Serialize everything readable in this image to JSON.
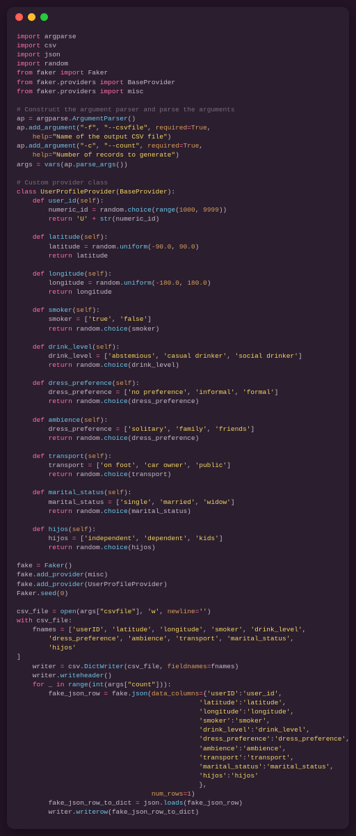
{
  "titlebar": {
    "red": "close",
    "yellow": "minimize",
    "green": "maximize"
  },
  "code": {
    "l1_kw1": "import",
    "l1_mod": "argparse",
    "l2_kw1": "import",
    "l2_mod": "csv",
    "l3_kw1": "import",
    "l3_mod": "json",
    "l4_kw1": "import",
    "l4_mod": "random",
    "l5_kw1": "from",
    "l5_mod1": "faker",
    "l5_kw2": "import",
    "l5_mod2": "Faker",
    "l6_kw1": "from",
    "l6_mod1": "faker.providers",
    "l6_kw2": "import",
    "l6_mod2": "BaseProvider",
    "l7_kw1": "from",
    "l7_mod1": "faker.providers",
    "l7_kw2": "import",
    "l7_mod2": "misc",
    "l9_c": "# Construct the argument parser and parse the arguments",
    "l10a": "ap ",
    "l10b": "=",
    "l10c": " argparse.",
    "l10d": "ArgumentParser",
    "l10e": "()",
    "l11a": "ap.",
    "l11b": "add_argument",
    "l11c": "(",
    "l11d": "\"-f\"",
    "l11e": ", ",
    "l11f": "\"--csvfile\"",
    "l11g": ", ",
    "l11h": "required",
    "l11i": "=",
    "l11j": "True",
    "l11k": ",",
    "l12a": "    ",
    "l12b": "help",
    "l12c": "=",
    "l12d": "\"Name of the output CSV file\"",
    "l12e": ")",
    "l13a": "ap.",
    "l13b": "add_argument",
    "l13c": "(",
    "l13d": "\"-c\"",
    "l13e": ", ",
    "l13f": "\"--count\"",
    "l13g": ", ",
    "l13h": "required",
    "l13i": "=",
    "l13j": "True",
    "l13k": ",",
    "l14a": "    ",
    "l14b": "help",
    "l14c": "=",
    "l14d": "\"Number of records to generate\"",
    "l14e": ")",
    "l15a": "args ",
    "l15b": "=",
    "l15c": " ",
    "l15d": "vars",
    "l15e": "(ap.",
    "l15f": "parse_args",
    "l15g": "())",
    "l17_c": "# Custom provider class",
    "l18_kw": "class",
    "l18_n": " UserProfileProvider",
    "l18_p": "(",
    "l18_b": "BaseProvider",
    "l18_e": "):",
    "l19_kw": "def",
    "l19_n": " user_id",
    "l19_p": "(",
    "l19_s": "self",
    "l19_e": "):",
    "l20a": "        numeric_id ",
    "l20b": "=",
    "l20c": " random.",
    "l20d": "choice",
    "l20e": "(",
    "l20f": "range",
    "l20g": "(",
    "l20h": "1000",
    "l20i": ", ",
    "l20j": "9999",
    "l20k": "))",
    "l21_kw": "return",
    "l21a": " ",
    "l21b": "'U'",
    "l21c": " ",
    "l21d": "+",
    "l21e": " ",
    "l21f": "str",
    "l21g": "(numeric_id)",
    "l23_kw": "def",
    "l23_n": " latitude",
    "l23_p": "(",
    "l23_s": "self",
    "l23_e": "):",
    "l24a": "        latitude ",
    "l24b": "=",
    "l24c": " random.",
    "l24d": "uniform",
    "l24e": "(",
    "l24f": "-",
    "l24g": "90.0",
    "l24h": ", ",
    "l24i": "90.0",
    "l24j": ")",
    "l25_kw": "return",
    "l25a": " latitude",
    "l27_kw": "def",
    "l27_n": " longitude",
    "l27_p": "(",
    "l27_s": "self",
    "l27_e": "):",
    "l28a": "        longitude ",
    "l28b": "=",
    "l28c": " random.",
    "l28d": "uniform",
    "l28e": "(",
    "l28f": "-",
    "l28g": "180.0",
    "l28h": ", ",
    "l28i": "180.0",
    "l28j": ")",
    "l29_kw": "return",
    "l29a": " longitude",
    "l31_kw": "def",
    "l31_n": " smoker",
    "l31_p": "(",
    "l31_s": "self",
    "l31_e": "):",
    "l32a": "        smoker ",
    "l32b": "=",
    "l32c": " [",
    "l32d": "'true'",
    "l32e": ", ",
    "l32f": "'false'",
    "l32g": "]",
    "l33_kw": "return",
    "l33a": " random.",
    "l33b": "choice",
    "l33c": "(smoker)",
    "l35_kw": "def",
    "l35_n": " drink_level",
    "l35_p": "(",
    "l35_s": "self",
    "l35_e": "):",
    "l36a": "        drink_level ",
    "l36b": "=",
    "l36c": " [",
    "l36d": "'abstemious'",
    "l36e": ", ",
    "l36f": "'casual drinker'",
    "l36g": ", ",
    "l36h": "'social drinker'",
    "l36i": "]",
    "l37_kw": "return",
    "l37a": " random.",
    "l37b": "choice",
    "l37c": "(drink_level)",
    "l39_kw": "def",
    "l39_n": " dress_preference",
    "l39_p": "(",
    "l39_s": "self",
    "l39_e": "):",
    "l40a": "        dress_preference ",
    "l40b": "=",
    "l40c": " [",
    "l40d": "'no preference'",
    "l40e": ", ",
    "l40f": "'informal'",
    "l40g": ", ",
    "l40h": "'formal'",
    "l40i": "]",
    "l41_kw": "return",
    "l41a": " random.",
    "l41b": "choice",
    "l41c": "(dress_preference)",
    "l43_kw": "def",
    "l43_n": " ambience",
    "l43_p": "(",
    "l43_s": "self",
    "l43_e": "):",
    "l44a": "        dress_preference ",
    "l44b": "=",
    "l44c": " [",
    "l44d": "'solitary'",
    "l44e": ", ",
    "l44f": "'family'",
    "l44g": ", ",
    "l44h": "'friends'",
    "l44i": "]",
    "l45_kw": "return",
    "l45a": " random.",
    "l45b": "choice",
    "l45c": "(dress_preference)",
    "l47_kw": "def",
    "l47_n": " transport",
    "l47_p": "(",
    "l47_s": "self",
    "l47_e": "):",
    "l48a": "        transport ",
    "l48b": "=",
    "l48c": " [",
    "l48d": "'on foot'",
    "l48e": ", ",
    "l48f": "'car owner'",
    "l48g": ", ",
    "l48h": "'public'",
    "l48i": "]",
    "l49_kw": "return",
    "l49a": " random.",
    "l49b": "choice",
    "l49c": "(transport)",
    "l51_kw": "def",
    "l51_n": " marital_status",
    "l51_p": "(",
    "l51_s": "self",
    "l51_e": "):",
    "l52a": "        marital_status ",
    "l52b": "=",
    "l52c": " [",
    "l52d": "'single'",
    "l52e": ", ",
    "l52f": "'married'",
    "l52g": ", ",
    "l52h": "'widow'",
    "l52i": "]",
    "l53_kw": "return",
    "l53a": " random.",
    "l53b": "choice",
    "l53c": "(marital_status)",
    "l55_kw": "def",
    "l55_n": " hijos",
    "l55_p": "(",
    "l55_s": "self",
    "l55_e": "):",
    "l56a": "        hijos ",
    "l56b": "=",
    "l56c": " [",
    "l56d": "'independent'",
    "l56e": ", ",
    "l56f": "'dependent'",
    "l56g": ", ",
    "l56h": "'kids'",
    "l56i": "]",
    "l57_kw": "return",
    "l57a": " random.",
    "l57b": "choice",
    "l57c": "(hijos)",
    "l59a": "fake ",
    "l59b": "=",
    "l59c": " ",
    "l59d": "Faker",
    "l59e": "()",
    "l60a": "fake.",
    "l60b": "add_provider",
    "l60c": "(misc)",
    "l61a": "fake.",
    "l61b": "add_provider",
    "l61c": "(UserProfileProvider)",
    "l62a": "Faker.",
    "l62b": "seed",
    "l62c": "(",
    "l62d": "0",
    "l62e": ")",
    "l64a": "csv_file ",
    "l64b": "=",
    "l64c": " ",
    "l64d": "open",
    "l64e": "(args[",
    "l64f": "\"csvfile\"",
    "l64g": "], ",
    "l64h": "'w'",
    "l64i": ", ",
    "l64j": "newline",
    "l64k": "=",
    "l64l": "''",
    "l64m": ")",
    "l65_kw": "with",
    "l65a": " csv_file:",
    "l66a": "    fnames ",
    "l66b": "=",
    "l66c": " [",
    "l66d": "'userID'",
    "l66e": ", ",
    "l66f": "'latitude'",
    "l66g": ", ",
    "l66h": "'longitude'",
    "l66i": ", ",
    "l66j": "'smoker'",
    "l66k": ", ",
    "l66l": "'drink_level'",
    "l66m": ",",
    "l67a": "        ",
    "l67b": "'dress_preference'",
    "l67c": ", ",
    "l67d": "'ambience'",
    "l67e": ", ",
    "l67f": "'transport'",
    "l67g": ", ",
    "l67h": "'marital_status'",
    "l67i": ",",
    "l68a": "        ",
    "l68b": "'hijos'",
    "l69a": "]",
    "l70a": "    writer ",
    "l70b": "=",
    "l70c": " csv.",
    "l70d": "DictWriter",
    "l70e": "(csv_file, ",
    "l70f": "fieldnames",
    "l70g": "=",
    "l70h": "fnames)",
    "l71a": "    writer.",
    "l71b": "writeheader",
    "l71c": "()",
    "l72_kw": "for",
    "l72a": " _ ",
    "l72b": "in",
    "l72c": " ",
    "l72d": "range",
    "l72e": "(",
    "l72f": "int",
    "l72g": "(args[",
    "l72h": "\"count\"",
    "l72i": "])):",
    "l73a": "        fake_json_row ",
    "l73b": "=",
    "l73c": " fake.",
    "l73d": "json",
    "l73e": "(",
    "l73f": "data_columns",
    "l73g": "=",
    "l73h": "{",
    "l73i": "'userID'",
    "l73j": ":",
    "l73k": "'user_id'",
    "l73l": ",",
    "l74a": "                                              ",
    "l74b": "'latitude'",
    "l74c": ":",
    "l74d": "'latitude'",
    "l74e": ",",
    "l75a": "                                              ",
    "l75b": "'longitude'",
    "l75c": ":",
    "l75d": "'longitude'",
    "l75e": ",",
    "l76a": "                                              ",
    "l76b": "'smoker'",
    "l76c": ":",
    "l76d": "'smoker'",
    "l76e": ",",
    "l77a": "                                              ",
    "l77b": "'drink_level'",
    "l77c": ":",
    "l77d": "'drink_level'",
    "l77e": ",",
    "l78a": "                                              ",
    "l78b": "'dress_preference'",
    "l78c": ":",
    "l78d": "'dress_preference'",
    "l78e": ",",
    "l79a": "                                              ",
    "l79b": "'ambience'",
    "l79c": ":",
    "l79d": "'ambience'",
    "l79e": ",",
    "l80a": "                                              ",
    "l80b": "'transport'",
    "l80c": ":",
    "l80d": "'transport'",
    "l80e": ",",
    "l81a": "                                              ",
    "l81b": "'marital_status'",
    "l81c": ":",
    "l81d": "'marital_status'",
    "l81e": ",",
    "l82a": "                                              ",
    "l82b": "'hijos'",
    "l82c": ":",
    "l82d": "'hijos'",
    "l83a": "                                              },",
    "l84a": "                                  ",
    "l84b": "num_rows",
    "l84c": "=",
    "l84d": "1",
    "l84e": ")",
    "l85a": "        fake_json_row_to_dict ",
    "l85b": "=",
    "l85c": " json.",
    "l85d": "loads",
    "l85e": "(fake_json_row)",
    "l86a": "        writer.",
    "l86b": "writerow",
    "l86c": "(fake_json_row_to_dict)"
  }
}
